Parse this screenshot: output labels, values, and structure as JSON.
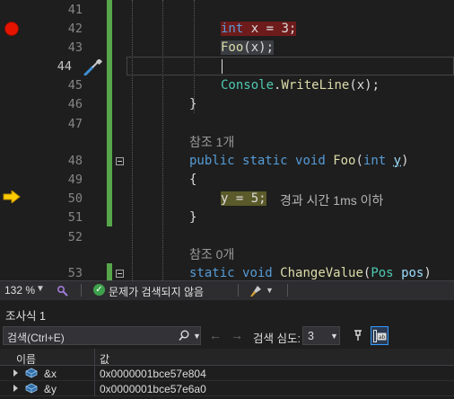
{
  "editor": {
    "lines": [
      {
        "num": "41"
      },
      {
        "num": "42",
        "code": "int x = 3;"
      },
      {
        "num": "43",
        "code": "Foo(x);"
      },
      {
        "num": "44"
      },
      {
        "num": "45",
        "code": "Console.WriteLine(x);"
      },
      {
        "num": "46",
        "code": "}"
      },
      {
        "num": "47"
      },
      {
        "num": "48",
        "code": "public static void Foo(int y)"
      },
      {
        "num": "49",
        "code": "{"
      },
      {
        "num": "50",
        "code": "y = 5;"
      },
      {
        "num": "51",
        "code": "}"
      },
      {
        "num": "52"
      },
      {
        "num": "53",
        "code": "static void ChangeValue(Pos pos)"
      }
    ],
    "code_tokens": {
      "l42": {
        "kw": "int",
        "rest": " x = 3;"
      },
      "l43": {
        "fn": "Foo",
        "rest": "(x);"
      },
      "l45": {
        "cls": "Console",
        "dot": ".",
        "fn": "WriteLine",
        "rest": "(x);"
      },
      "l48": {
        "kw1": "public",
        "kw2": "static",
        "kw3": "void",
        "fn": "Foo",
        "p1": "(",
        "kw4": "int",
        "pm": "y",
        "p2": ")"
      },
      "l50": {
        "text": "y = 5;"
      },
      "l53": {
        "kw1": "static",
        "kw2": "void",
        "fn": "ChangeValue",
        "p1": "(",
        "cls": "Pos",
        "pm": "pos",
        "p2": ")"
      }
    },
    "code_lens": [
      "참조 1개",
      "참조 0개"
    ],
    "elapsed_hint": "경과 시간 1ms 이하",
    "breakpoint_line": "42",
    "execution_line": "50",
    "current_line": "44"
  },
  "status_bar": {
    "zoom": "132 %",
    "status_text": "문제가 검색되지 않음"
  },
  "watch": {
    "title": "조사식 1",
    "search_placeholder": "검색(Ctrl+E)",
    "depth_label": "검색 심도:",
    "depth_value": "3",
    "columns": {
      "name": "이름",
      "value": "값"
    },
    "rows": [
      {
        "name": "&x",
        "value": "0x0000001bce57e804"
      },
      {
        "name": "&y",
        "value": "0x0000001bce57e6a0"
      }
    ]
  },
  "colors": {
    "background": "#1e1e1e",
    "breakpoint": "#e51400",
    "breakpoint_line_bg": "#6e1b1b",
    "instruction_pointer": "#ffcc00",
    "change_bar": "#57a64a",
    "keyword": "#569cd6",
    "function": "#dcdcaa",
    "type": "#4ec9b0",
    "parameter": "#9cdcfe"
  }
}
